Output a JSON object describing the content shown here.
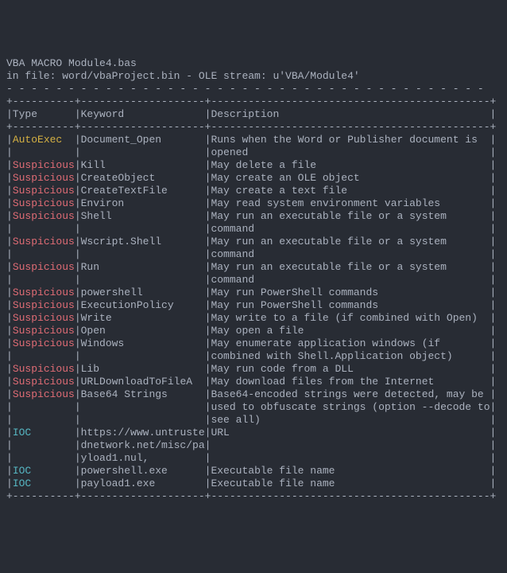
{
  "header": {
    "line1": "VBA MACRO Module4.bas",
    "line2": "in file: word/vbaProject.bin - OLE stream: u'VBA/Module4'"
  },
  "dash_line": "- - - - - - - - - - - - - - - - - - - - - - - - - - - - - - - - - - - - - - - ",
  "border_line": "+----------+--------------------+---------------------------------------------+",
  "columns": {
    "type": "Type",
    "keyword": "Keyword",
    "description": "Description"
  },
  "rows": [
    {
      "type": "AutoExec",
      "type_class": "autoexec",
      "keyword": [
        "Document_Open"
      ],
      "desc": [
        "Runs when the Word or Publisher document is",
        "opened"
      ]
    },
    {
      "type": "Suspicious",
      "type_class": "suspicious",
      "keyword": [
        "Kill"
      ],
      "desc": [
        "May delete a file"
      ]
    },
    {
      "type": "Suspicious",
      "type_class": "suspicious",
      "keyword": [
        "CreateObject"
      ],
      "desc": [
        "May create an OLE object"
      ]
    },
    {
      "type": "Suspicious",
      "type_class": "suspicious",
      "keyword": [
        "CreateTextFile"
      ],
      "desc": [
        "May create a text file"
      ]
    },
    {
      "type": "Suspicious",
      "type_class": "suspicious",
      "keyword": [
        "Environ"
      ],
      "desc": [
        "May read system environment variables"
      ]
    },
    {
      "type": "Suspicious",
      "type_class": "suspicious",
      "keyword": [
        "Shell"
      ],
      "desc": [
        "May run an executable file or a system",
        "command"
      ]
    },
    {
      "type": "Suspicious",
      "type_class": "suspicious",
      "keyword": [
        "Wscript.Shell"
      ],
      "desc": [
        "May run an executable file or a system",
        "command"
      ]
    },
    {
      "type": "Suspicious",
      "type_class": "suspicious",
      "keyword": [
        "Run"
      ],
      "desc": [
        "May run an executable file or a system",
        "command"
      ]
    },
    {
      "type": "Suspicious",
      "type_class": "suspicious",
      "keyword": [
        "powershell"
      ],
      "desc": [
        "May run PowerShell commands"
      ]
    },
    {
      "type": "Suspicious",
      "type_class": "suspicious",
      "keyword": [
        "ExecutionPolicy"
      ],
      "desc": [
        "May run PowerShell commands"
      ]
    },
    {
      "type": "Suspicious",
      "type_class": "suspicious",
      "keyword": [
        "Write"
      ],
      "desc": [
        "May write to a file (if combined with Open)"
      ]
    },
    {
      "type": "Suspicious",
      "type_class": "suspicious",
      "keyword": [
        "Open"
      ],
      "desc": [
        "May open a file"
      ]
    },
    {
      "type": "Suspicious",
      "type_class": "suspicious",
      "keyword": [
        "Windows"
      ],
      "desc": [
        "May enumerate application windows (if",
        "combined with Shell.Application object)"
      ]
    },
    {
      "type": "Suspicious",
      "type_class": "suspicious",
      "keyword": [
        "Lib"
      ],
      "desc": [
        "May run code from a DLL"
      ]
    },
    {
      "type": "Suspicious",
      "type_class": "suspicious",
      "keyword": [
        "URLDownloadToFileA"
      ],
      "desc": [
        "May download files from the Internet"
      ]
    },
    {
      "type": "Suspicious",
      "type_class": "suspicious",
      "keyword": [
        "Base64 Strings"
      ],
      "desc": [
        "Base64-encoded strings were detected, may be",
        "used to obfuscate strings (option --decode to",
        "see all)"
      ]
    },
    {
      "type": "IOC",
      "type_class": "ioc",
      "keyword": [
        "https://www.untruste",
        "dnetwork.net/misc/pa",
        "yload1.nul,"
      ],
      "desc": [
        "URL"
      ]
    },
    {
      "type": "IOC",
      "type_class": "ioc",
      "keyword": [
        "powershell.exe"
      ],
      "desc": [
        "Executable file name"
      ]
    },
    {
      "type": "IOC",
      "type_class": "ioc",
      "keyword": [
        "payload1.exe"
      ],
      "desc": [
        "Executable file name"
      ]
    }
  ],
  "widths": {
    "type": 10,
    "keyword": 20,
    "desc": 45
  }
}
